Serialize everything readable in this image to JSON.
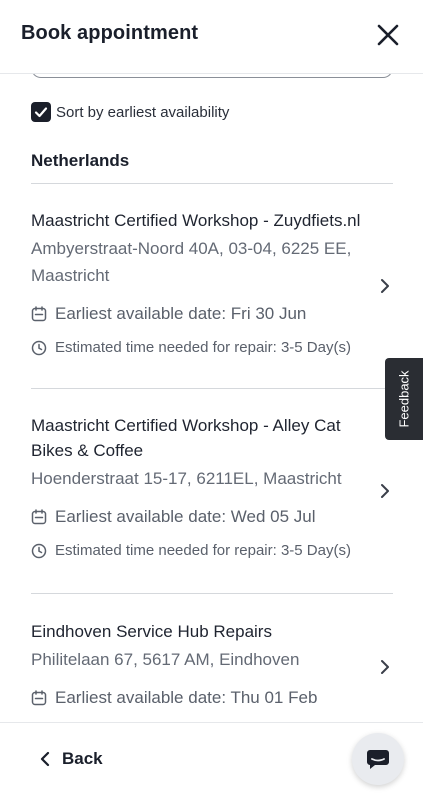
{
  "header": {
    "title": "Book appointment"
  },
  "sort": {
    "label": "Sort by earliest availability",
    "checked": true
  },
  "country": "Netherlands",
  "shops": [
    {
      "name": "Maastricht Certified Workshop - Zuydfiets.nl",
      "address": "Ambyerstraat-Noord 40A, 03-04, 6225 EE, Maastricht",
      "earliest": "Earliest available date: Fri 30 Jun",
      "repair_time": "Estimated time needed for repair: 3-5 Day(s)"
    },
    {
      "name": "Maastricht Certified Workshop - Alley Cat Bikes & Coffee",
      "address": "Hoenderstraat 15-17, 6211EL, Maastricht",
      "earliest": "Earliest available date: Wed 05 Jul",
      "repair_time": "Estimated time needed for repair: 3-5 Day(s)"
    },
    {
      "name": "Eindhoven Service Hub Repairs",
      "address": "Philitelaan 67, 5617 AM, Eindhoven",
      "earliest": "Earliest available date: Thu 01 Feb"
    }
  ],
  "feedback": "Feedback",
  "footer": {
    "back_label": "Back"
  }
}
